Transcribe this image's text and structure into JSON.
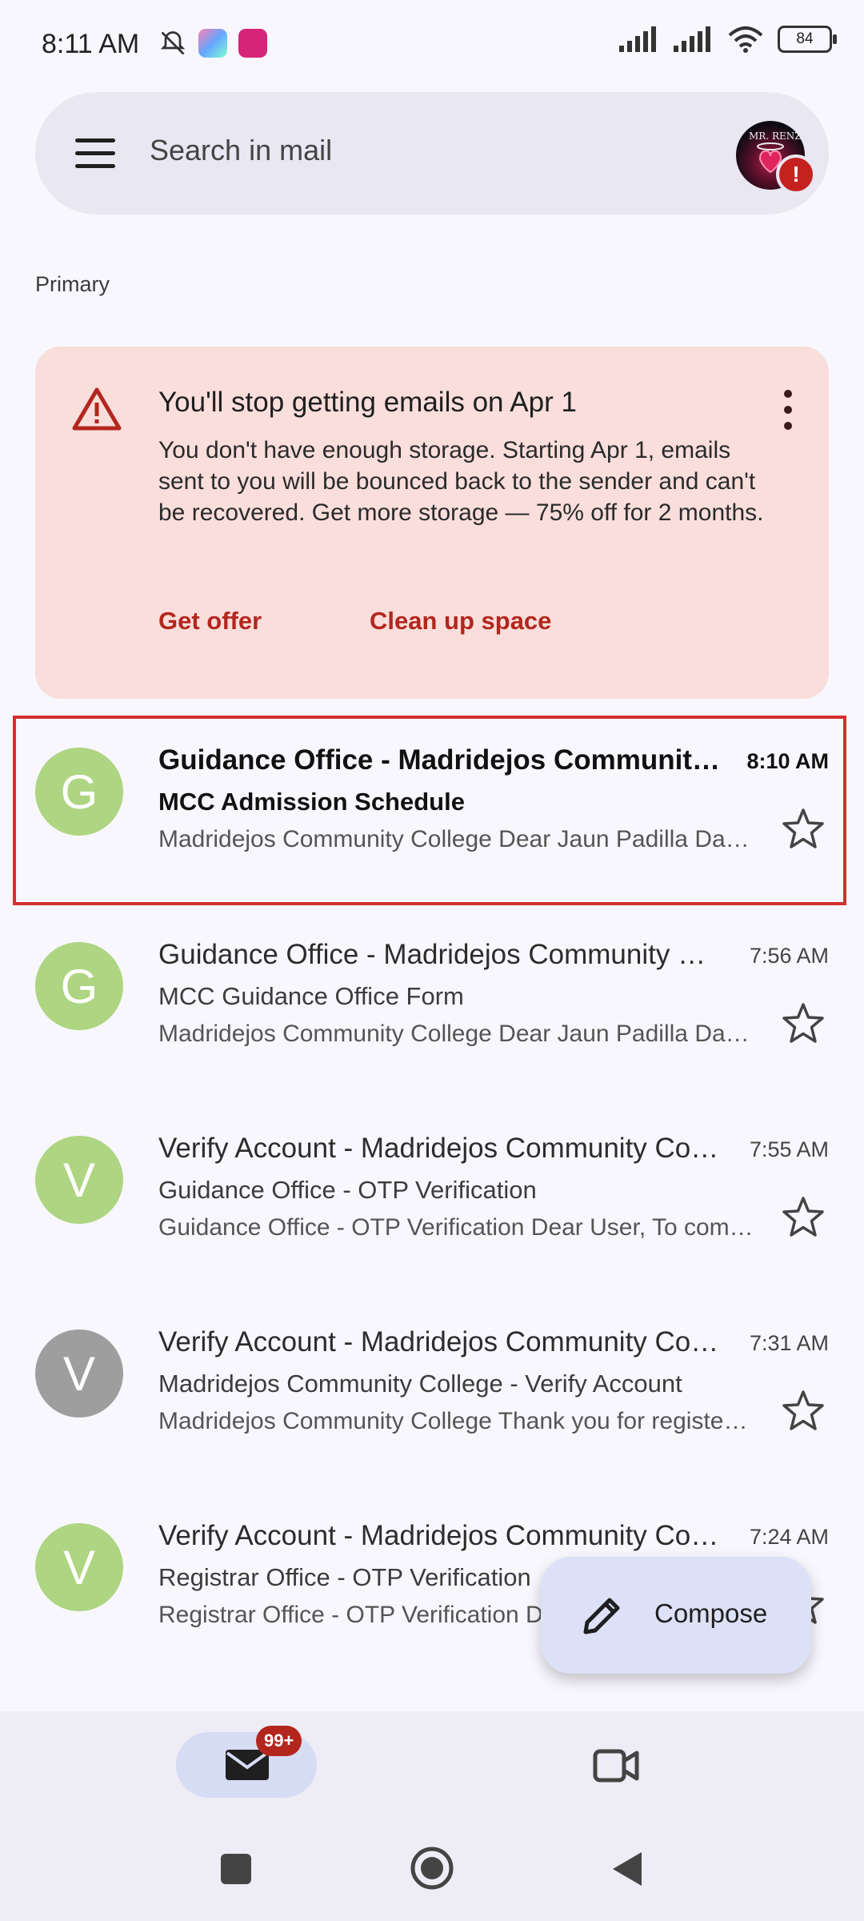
{
  "status_bar": {
    "time": "8:11 AM",
    "battery": "84"
  },
  "search": {
    "placeholder": "Search in mail",
    "avatar_text": "MR. RENZ"
  },
  "section": {
    "label": "Primary"
  },
  "storage_card": {
    "title": "You'll stop getting emails on Apr 1",
    "body": "You don't have enough storage. Starting Apr 1, emails sent to you will be bounced back to the sender and can't be recovered. Get more storage — 75% off for 2 months.",
    "action_offer": "Get offer",
    "action_clean": "Clean up space"
  },
  "emails": [
    {
      "initial": "G",
      "avatar_color": "#aed581",
      "sender": "Guidance Office - Madridejos Community College",
      "time": "8:10 AM",
      "subject": "MCC Admission Schedule",
      "snippet": "Madridejos Community College Dear Jaun Padilla Dapat",
      "unread": true
    },
    {
      "initial": "G",
      "avatar_color": "#aed581",
      "sender": "Guidance Office - Madridejos Community College",
      "time": "7:56 AM",
      "subject": "MCC Guidance Office Form",
      "snippet": "Madridejos Community College Dear Jaun Padilla Dapat",
      "unread": false
    },
    {
      "initial": "V",
      "avatar_color": "#aed581",
      "sender": "Verify Account - Madridejos Community College",
      "time": "7:55 AM",
      "subject": "Guidance Office - OTP Verification",
      "snippet": "Guidance Office - OTP Verification Dear User, To complete",
      "unread": false
    },
    {
      "initial": "V",
      "avatar_color": "#9e9e9e",
      "sender": "Verify Account - Madridejos Community College",
      "time": "7:31 AM",
      "subject": "Madridejos Community College - Verify Account",
      "snippet": "Madridejos Community College Thank you for registering",
      "unread": false
    },
    {
      "initial": "V",
      "avatar_color": "#aed581",
      "sender": "Verify Account - Madridejos Community College",
      "time": "7:24 AM",
      "subject": "Registrar Office - OTP Verification",
      "snippet": "Registrar Office - OTP Verification Dear User",
      "unread": false
    }
  ],
  "compose": {
    "label": "Compose"
  },
  "bottom_nav": {
    "mail_badge": "99+"
  },
  "colors": {
    "accent_red": "#b3261e",
    "highlight_border": "#d32f2f"
  }
}
